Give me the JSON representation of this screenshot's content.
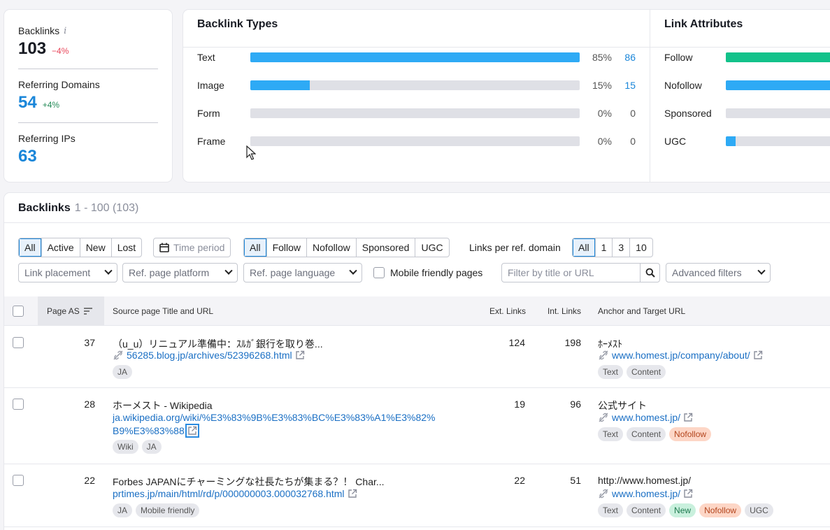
{
  "summary": {
    "backlinks_label": "Backlinks",
    "backlinks_value": "103",
    "backlinks_delta": "−4%",
    "domains_label": "Referring Domains",
    "domains_value": "54",
    "domains_delta": "+4%",
    "ips_label": "Referring IPs",
    "ips_value": "63"
  },
  "backlink_types": {
    "title": "Backlink Types",
    "rows": [
      {
        "label": "Text",
        "pct": "85%",
        "count": "86",
        "fill": 1.0,
        "color": "#2eaaf5"
      },
      {
        "label": "Image",
        "pct": "15%",
        "count": "15",
        "fill": 0.18,
        "color": "#2eaaf5"
      },
      {
        "label": "Form",
        "pct": "0%",
        "count": "0",
        "fill": 0,
        "color": "#2eaaf5"
      },
      {
        "label": "Frame",
        "pct": "0%",
        "count": "0",
        "fill": 0,
        "color": "#2eaaf5"
      }
    ]
  },
  "link_attributes": {
    "title": "Link Attributes",
    "rows": [
      {
        "label": "Follow",
        "fill": 1.0,
        "color": "#12c28a"
      },
      {
        "label": "Nofollow",
        "fill": 1.0,
        "color": "#2eaaf5"
      },
      {
        "label": "Sponsored",
        "fill": 0,
        "color": "#2eaaf5"
      },
      {
        "label": "UGC",
        "fill": 0.09,
        "color": "#2eaaf5"
      }
    ]
  },
  "backlinks_table": {
    "title": "Backlinks",
    "range": "1 - 100 (103)",
    "status_filter": [
      "All",
      "Active",
      "New",
      "Lost"
    ],
    "time_period": "Time period",
    "type_filter": [
      "All",
      "Follow",
      "Nofollow",
      "Sponsored",
      "UGC"
    ],
    "links_per_domain_label": "Links per ref. domain",
    "links_per_domain": [
      "All",
      "1",
      "3",
      "10"
    ],
    "link_placement": "Link placement",
    "ref_platform": "Ref. page platform",
    "ref_language": "Ref. page language",
    "mobile_friendly": "Mobile friendly pages",
    "search_placeholder": "Filter by title or URL",
    "advanced_filters": "Advanced filters",
    "columns": {
      "page_as": "Page AS",
      "source": "Source page Title and URL",
      "ext_links": "Ext. Links",
      "int_links": "Int. Links",
      "anchor": "Anchor and Target URL"
    },
    "rows": [
      {
        "page_as": "37",
        "title": "（u_u）リニュアル準備中：ｽﾙｶﾞ銀行を取り巻...",
        "url": "56285.blog.jp/archives/52396268.html",
        "source_tags": [
          "JA"
        ],
        "ext_links": "124",
        "int_links": "198",
        "anchor": "ﾎｰﾒｽﾄ",
        "target": "www.homest.jp/company/about/",
        "anchor_tags": [
          "Text",
          "Content"
        ]
      },
      {
        "page_as": "28",
        "title": "ホーメスト - Wikipedia",
        "url_line1": "ja.wikipedia.org/wiki/%E3%83%9B%E3%83%BC%E3%83%A1%E3%82%",
        "url_line2": "B9%E3%83%88",
        "source_tags": [
          "Wiki",
          "JA"
        ],
        "ext_links": "19",
        "int_links": "96",
        "anchor": "公式サイト",
        "target": "www.homest.jp/",
        "anchor_tags": [
          "Text",
          "Content",
          "Nofollow"
        ]
      },
      {
        "page_as": "22",
        "title": "Forbes JAPANにチャーミングな社長たちが集まる？！ Char...",
        "url": "prtimes.jp/main/html/rd/p/000000003.000032768.html",
        "source_tags": [
          "JA",
          "Mobile friendly"
        ],
        "ext_links": "22",
        "int_links": "51",
        "anchor": "http://www.homest.jp/",
        "target": "www.homest.jp/",
        "anchor_tags": [
          "Text",
          "Content",
          "New",
          "Nofollow",
          "UGC"
        ]
      }
    ]
  }
}
